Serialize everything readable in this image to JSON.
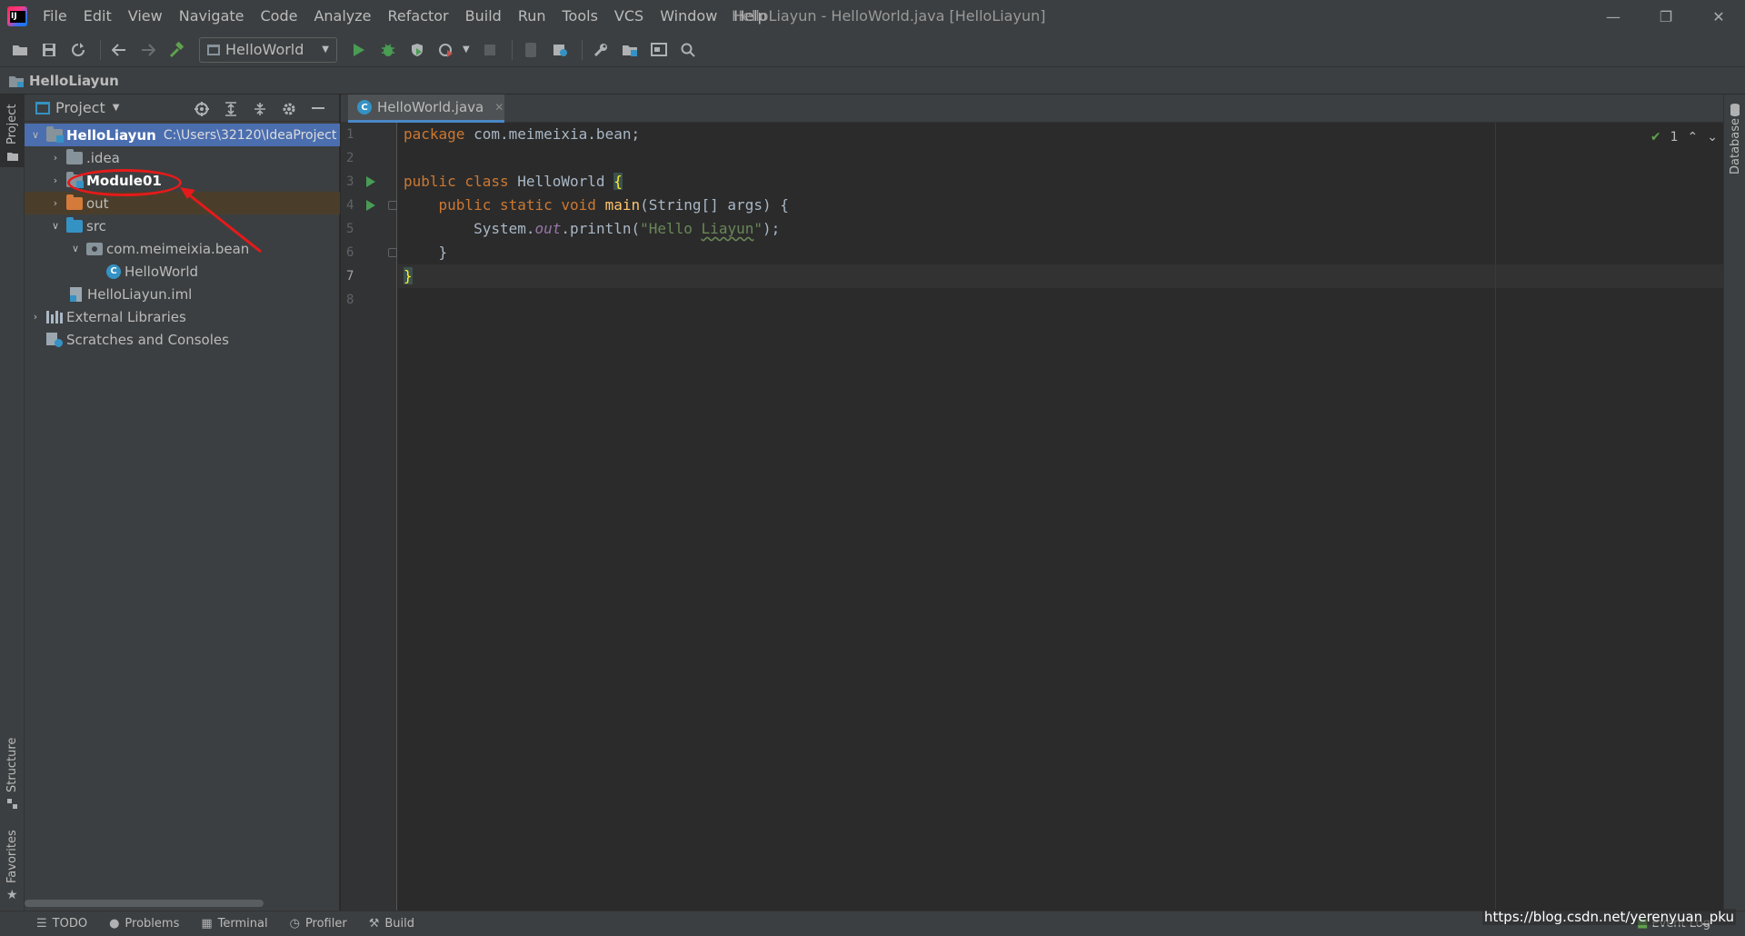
{
  "window": {
    "title": "HelloLiayun - HelloWorld.java [HelloLiayun]",
    "minimize": "—",
    "restore": "❐",
    "close": "✕"
  },
  "menu": [
    "File",
    "Edit",
    "View",
    "Navigate",
    "Code",
    "Analyze",
    "Refactor",
    "Build",
    "Run",
    "Tools",
    "VCS",
    "Window",
    "Help"
  ],
  "toolbar": {
    "run_config": "HelloWorld",
    "icons": [
      "open-icon",
      "save-icon",
      "sync-icon",
      "back-icon",
      "forward-icon",
      "build-icon",
      "run-icon",
      "debug-icon",
      "coverage-icon",
      "profile-icon",
      "stop-icon",
      "device-icon",
      "database-sync-icon",
      "settings-icon",
      "project-structure-icon",
      "presentation-icon",
      "search-icon"
    ]
  },
  "breadcrumb": {
    "project": "HelloLiayun"
  },
  "left_strip": {
    "project": "Project",
    "structure": "Structure",
    "favorites": "Favorites"
  },
  "right_strip": {
    "database": "Database"
  },
  "project_panel": {
    "title": "Project",
    "tree": {
      "root_name": "HelloLiayun",
      "root_path": "C:\\Users\\32120\\IdeaProject",
      "idea": ".idea",
      "module": "Module01",
      "out": "out",
      "src": "src",
      "package": "com.meimeixia.bean",
      "class": "HelloWorld",
      "iml": "HelloLiayun.iml",
      "libraries": "External Libraries",
      "scratches": "Scratches and Consoles"
    }
  },
  "editor": {
    "tab_label": "HelloWorld.java",
    "line_numbers": [
      "1",
      "2",
      "3",
      "4",
      "5",
      "6",
      "7",
      "8"
    ],
    "code": {
      "l1_kw": "package",
      "l1_rest": " com.meimeixia.bean;",
      "l3_kw": "public class",
      "l3_name": " HelloWorld ",
      "l3_brace": "{",
      "l4_indent": "    ",
      "l4_kw": "public static void",
      "l4_sp": " ",
      "l4_fn": "main",
      "l4_rest": "(String[] args) {",
      "l5_pre": "        System.",
      "l5_field": "out",
      "l5_mid": ".println(",
      "l5_str_a": "\"Hello ",
      "l5_str_b": "Liayun",
      "l5_str_c": "\"",
      "l5_end": ");",
      "l6": "    }",
      "l7": "}"
    },
    "inspection_count": "1",
    "inspection_check": "✔"
  },
  "bottom_bar": {
    "todo": "TODO",
    "problems": "Problems",
    "terminal": "Terminal",
    "profiler": "Profiler",
    "build": "Build",
    "event_log": "Event Log"
  },
  "watermark": "https://blog.csdn.net/yerenyuan_pku",
  "colors": {
    "background": "#2b2b2b",
    "panel": "#3c3f41",
    "selection": "#4b6eaf",
    "keyword": "#cc7832",
    "string": "#6a8759",
    "method": "#ffc66d",
    "annotation": "#e61a1a"
  }
}
